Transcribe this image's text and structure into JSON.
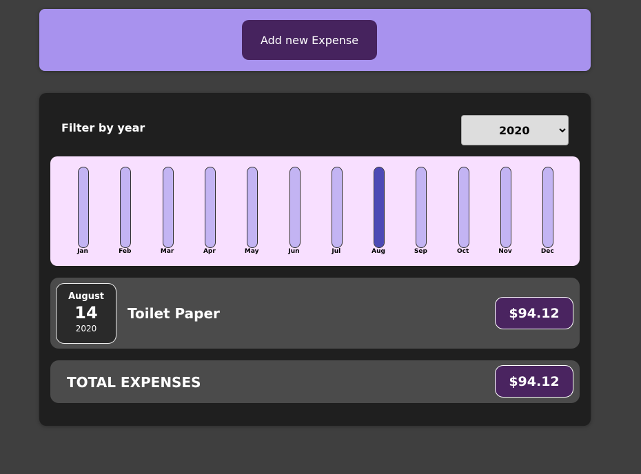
{
  "new_expense": {
    "add_button_label": "Add new Expense"
  },
  "filter": {
    "label": "Filter by year",
    "selected_year": "2020"
  },
  "chart_data": {
    "type": "bar",
    "categories": [
      "Jan",
      "Feb",
      "Mar",
      "Apr",
      "May",
      "Jun",
      "Jul",
      "Aug",
      "Sep",
      "Oct",
      "Nov",
      "Dec"
    ],
    "values": [
      0,
      0,
      0,
      0,
      0,
      0,
      0,
      94.12,
      0,
      0,
      0,
      0
    ],
    "max_value": 94.12,
    "colors": {
      "track": "#c3b4f3",
      "fill": "#4d49b5",
      "background": "#f8dfff"
    }
  },
  "expenses": [
    {
      "month": "August",
      "day": "14",
      "year": "2020",
      "title": "Toilet Paper",
      "amount": "$94.12"
    }
  ],
  "total": {
    "label": "TOTAL EXPENSES",
    "amount": "$94.12"
  }
}
